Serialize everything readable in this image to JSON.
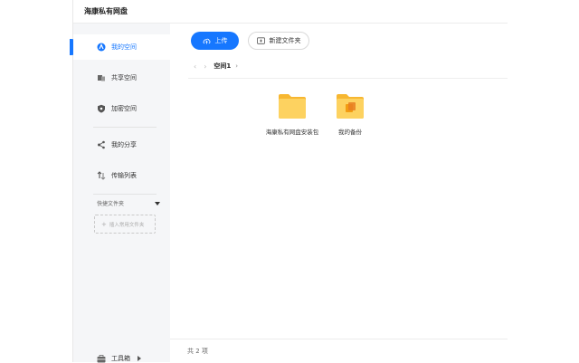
{
  "app": {
    "title": "海康私有网盘"
  },
  "sidebar": {
    "items": [
      {
        "label": "我的空间",
        "icon": "user-space-icon",
        "active": true
      },
      {
        "label": "共享空间",
        "icon": "shared-space-icon",
        "active": false
      },
      {
        "label": "加密空间",
        "icon": "shield-icon",
        "active": false
      },
      {
        "label": "我的分享",
        "icon": "share-icon",
        "active": false
      },
      {
        "label": "传输列表",
        "icon": "transfer-icon",
        "active": false
      }
    ],
    "quick_folder": {
      "header": "快捷文件夹",
      "insert_label": "插入常用文件夹"
    },
    "toolbox_label": "工具箱"
  },
  "toolbar": {
    "upload_label": "上传",
    "new_folder_label": "新建文件夹"
  },
  "breadcrumb": {
    "current": "空间1"
  },
  "files": [
    {
      "name": "海康私有网盘安装包",
      "icon": "folder-icon"
    },
    {
      "name": "我的备份",
      "icon": "backup-folder-icon"
    }
  ],
  "footer": {
    "count_text": "共 2 项"
  },
  "colors": {
    "accent": "#1677ff",
    "folder": "#fbc84d",
    "sidebar_bg": "#f5f6f8"
  }
}
